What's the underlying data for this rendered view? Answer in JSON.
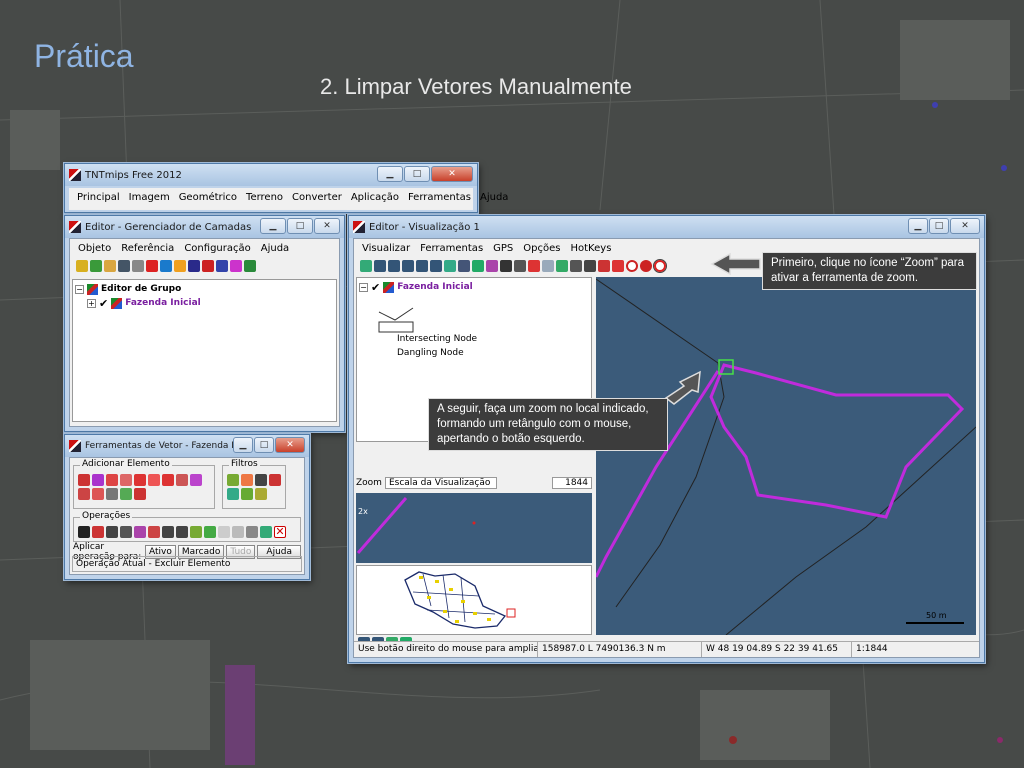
{
  "slide": {
    "title": "Prática",
    "subtitle": "2. Limpar Vetores Manualmente"
  },
  "tntmips": {
    "title": "TNTmips Free 2012",
    "menu": [
      "Principal",
      "Imagem",
      "Geométrico",
      "Terreno",
      "Converter",
      "Aplicação",
      "Ferramentas",
      "Ajuda"
    ]
  },
  "layer_manager": {
    "title": "Editor - Gerenciador de Camadas",
    "menu": [
      "Objeto",
      "Referência",
      "Configuração",
      "Ajuda"
    ],
    "group": "Editor de Grupo",
    "layer": "Fazenda Inicial"
  },
  "vector_tools": {
    "title": "Ferramentas de Vetor - Fazenda I...",
    "add_element": "Adicionar Elemento",
    "filters": "Filtros",
    "operations": "Operações",
    "apply_label": "Aplicar operação para:",
    "apply_options": [
      "Ativo",
      "Marcado",
      "Tudo"
    ],
    "help": "Ajuda",
    "current_op": "Operação Atual - Excluir Elemento"
  },
  "view": {
    "title": "Editor - Visualização 1",
    "menu": [
      "Visualizar",
      "Ferramentas",
      "GPS",
      "Opções",
      "HotKeys"
    ],
    "layer": "Fazenda Inicial",
    "legend": [
      "Intersecting Node",
      "Dangling Node"
    ],
    "zoom_label": "Zoom",
    "zoom_mode": "Escala da Visualização",
    "zoom_value": "1844",
    "zoom_factor": "2x",
    "scalebar": "50 m",
    "status": {
      "hint": "Use botão direito do mouse para ampliar a",
      "coords": "158987.0 L 7490136.3 N m",
      "latlon": "W 48 19 04.89  S 22 39 41.65",
      "scale": "1:1844"
    }
  },
  "callouts": {
    "first": "Primeiro, clique no ícone “Zoom” para ativar a ferramenta de zoom.",
    "second": "A seguir, faça um zoom no local indicado, formando um retângulo com o mouse, apertando o botão esquerdo."
  },
  "colors": {
    "map_water": "#3b5b7a",
    "polygon": "#c02bdc",
    "title_blue": "#8fb4e3"
  }
}
